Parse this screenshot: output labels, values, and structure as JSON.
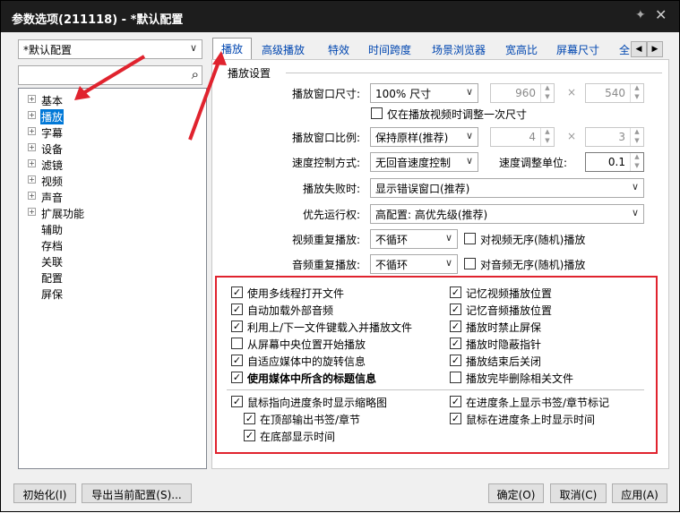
{
  "window": {
    "title": "参数选项(211118) - *默认配置",
    "pin_icon": "pin-icon",
    "close_icon": "close-icon"
  },
  "sidebar": {
    "profile_select": "*默认配置",
    "search_placeholder": "",
    "tree": [
      {
        "label": "基本",
        "expandable": true
      },
      {
        "label": "播放",
        "expandable": true,
        "selected": true
      },
      {
        "label": "字幕",
        "expandable": true
      },
      {
        "label": "设备",
        "expandable": true
      },
      {
        "label": "滤镜",
        "expandable": true
      },
      {
        "label": "视频",
        "expandable": true
      },
      {
        "label": "声音",
        "expandable": true
      },
      {
        "label": "扩展功能",
        "expandable": true
      },
      {
        "label": "辅助",
        "expandable": false
      },
      {
        "label": "存档",
        "expandable": false
      },
      {
        "label": "关联",
        "expandable": false
      },
      {
        "label": "配置",
        "expandable": false
      },
      {
        "label": "屏保",
        "expandable": false
      }
    ]
  },
  "tabs": [
    "播放",
    "高级播放",
    "特效",
    "时间跨度",
    "场景浏览器",
    "宽高比",
    "屏幕尺寸",
    "全"
  ],
  "panel": {
    "group_title": "播放设置",
    "window_size_label": "播放窗口尺寸:",
    "window_size_value": "100% 尺寸",
    "width_value": "960",
    "height_value": "540",
    "times": "×",
    "resize_once_label": "仅在播放视频时调整一次尺寸",
    "aspect_label": "播放窗口比例:",
    "aspect_value": "保持原样(推荐)",
    "aspect_w": "4",
    "aspect_h": "3",
    "speed_mode_label": "速度控制方式:",
    "speed_mode_value": "无回音速度控制",
    "speed_unit_label": "速度调整单位:",
    "speed_unit_value": "0.1",
    "fail_label": "播放失败时:",
    "fail_value": "显示错误窗口(推荐)",
    "priority_label": "优先运行权:",
    "priority_value": "高配置: 高优先级(推荐)",
    "video_repeat_label": "视频重复播放:",
    "video_repeat_value": "不循环",
    "video_shuffle_label": "对视频无序(随机)播放",
    "audio_repeat_label": "音频重复播放:",
    "audio_repeat_value": "不循环",
    "audio_shuffle_label": "对音频无序(随机)播放",
    "options_left": [
      {
        "label": "使用多线程打开文件",
        "checked": true
      },
      {
        "label": "自动加载外部音频",
        "checked": true
      },
      {
        "label": "利用上/下一文件键载入并播放文件",
        "checked": true
      },
      {
        "label": "从屏幕中央位置开始播放",
        "checked": false
      },
      {
        "label": "自适应媒体中的旋转信息",
        "checked": true
      },
      {
        "label": "使用媒体中所含的标题信息",
        "checked": true,
        "bold": true
      }
    ],
    "options_right": [
      {
        "label": "记忆视频播放位置",
        "checked": true
      },
      {
        "label": "记忆音频播放位置",
        "checked": true
      },
      {
        "label": "播放时禁止屏保",
        "checked": true
      },
      {
        "label": "播放时隐蔽指针",
        "checked": true
      },
      {
        "label": "播放结束后关闭",
        "checked": true
      },
      {
        "label": "播放完毕删除相关文件",
        "checked": false
      }
    ],
    "seek_thumb_label": "鼠标指向进度条时显示缩略图",
    "seek_thumb_top_label": "在顶部输出书签/章节",
    "seek_thumb_bottom_label": "在底部显示时间",
    "seek_bookmark_label": "在进度条上显示书签/章节标记",
    "seek_time_label": "鼠标在进度条上时显示时间"
  },
  "footer": {
    "init_button": "初始化(I)",
    "export_button": "导出当前配置(S)...",
    "ok_button": "确定(O)",
    "cancel_button": "取消(C)",
    "apply_button": "应用(A)"
  },
  "colors": {
    "highlight": "#e0232e",
    "selection": "#0078d7",
    "tab_text": "#0046b0"
  }
}
